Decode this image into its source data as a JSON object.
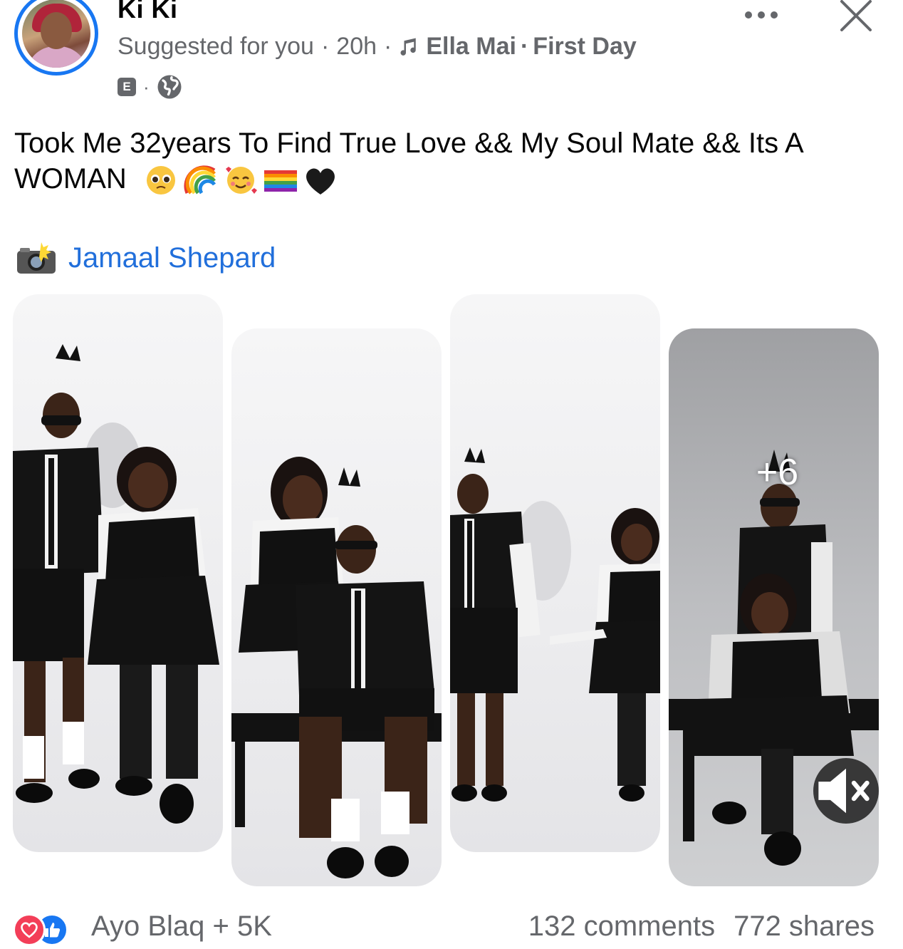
{
  "post": {
    "author": "Ki Ki",
    "suggested": "Suggested for you",
    "time": "20h",
    "music_artist": "Ella Mai",
    "music_song": "First Day",
    "badge": "E",
    "caption": "Took Me  32years To Find True Love && My Soul Mate && Its A WOMAN",
    "emojis": [
      "pleading-face-emoji",
      "rainbow-emoji",
      "smiling-hearts-emoji",
      "rainbow-flag-emoji",
      "black-heart-emoji"
    ],
    "credit_name": "Jamaal Shepard",
    "more_photos": "+6"
  },
  "footer": {
    "reactions_text": "Ayo Blaq + 5K",
    "comments": "132 comments",
    "shares": "772 shares"
  },
  "colors": {
    "accent": "#1877f2",
    "link": "#216fdb",
    "meta": "#65676b",
    "love": "#f33e58"
  }
}
